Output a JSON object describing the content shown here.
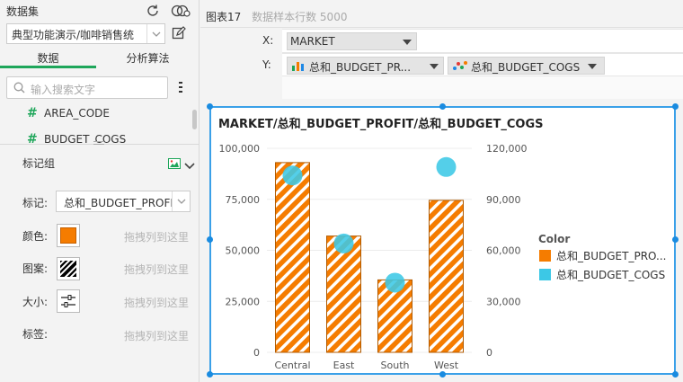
{
  "left_panel": {
    "dataset_label": "数据集",
    "dataset_value": "典型功能演示/咖啡销售统",
    "tabs": [
      {
        "label": "数据",
        "active": true
      },
      {
        "label": "分析算法",
        "active": false
      }
    ],
    "search_placeholder": "输入搜索文字",
    "fields": [
      {
        "label": "AREA_CODE"
      },
      {
        "label": "BUDGET_COGS"
      }
    ],
    "mark_group_title": "标记组",
    "mark_label": "标记:",
    "mark_value": "总和_BUDGET_PROFIT",
    "props": [
      {
        "label": "颜色:",
        "hint": "拖拽列到这里"
      },
      {
        "label": "图案:",
        "hint": "拖拽列到这里"
      },
      {
        "label": "大小:",
        "hint": "拖拽列到这里"
      },
      {
        "label": "标签:",
        "hint": "拖拽列到这里"
      }
    ],
    "colors": {
      "accent_green": "#1ea65a",
      "swatch_orange": "#f57c00"
    }
  },
  "right_panel": {
    "chart_name": "图表17",
    "row_count_text": "数据样本行数 5000",
    "x_label": "X:",
    "x_value": "MARKET",
    "y_label": "Y:",
    "y_pills": [
      {
        "label": "总和_BUDGET_PR...",
        "icon": "bar-chart-icon"
      },
      {
        "label": "总和_BUDGET_COGS",
        "icon": "scatter-icon"
      }
    ]
  },
  "chart_data": {
    "type": "bar",
    "title": "MARKET/总和_BUDGET_PROFIT/总和_BUDGET_COGS",
    "categories": [
      "Central",
      "East",
      "South",
      "West"
    ],
    "series": [
      {
        "name": "总和_BUDGET_PRO...",
        "type": "bar",
        "axis": "left",
        "color": "#f57c00",
        "pattern": "diagonal-stripes",
        "values": [
          93000,
          57000,
          35500,
          74500
        ]
      },
      {
        "name": "总和_BUDGET_COGS",
        "type": "scatter",
        "axis": "right",
        "color": "#3cc8e6",
        "values": [
          104000,
          64000,
          41000,
          109000
        ]
      }
    ],
    "y_left": {
      "ylim": [
        0,
        100000
      ],
      "ticks": [
        "100,000",
        "75,000",
        "50,000",
        "25,000",
        "0"
      ]
    },
    "y_right": {
      "ylim": [
        0,
        120000
      ],
      "ticks": [
        "120,000",
        "90,000",
        "60,000",
        "30,000",
        "0"
      ]
    },
    "legend_title": "Color",
    "legend_placement": "right",
    "grid": true
  }
}
